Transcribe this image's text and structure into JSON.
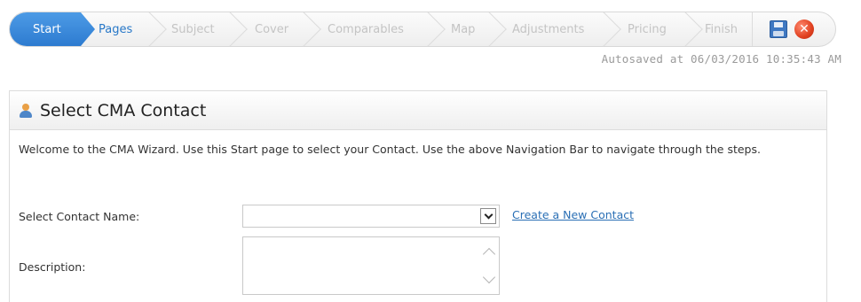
{
  "wizard": {
    "steps": [
      {
        "label": "Start",
        "state": "active"
      },
      {
        "label": "Pages",
        "state": "current"
      },
      {
        "label": "Subject",
        "state": "disabled"
      },
      {
        "label": "Cover",
        "state": "disabled"
      },
      {
        "label": "Comparables",
        "state": "disabled"
      },
      {
        "label": "Map",
        "state": "disabled"
      },
      {
        "label": "Adjustments",
        "state": "disabled"
      },
      {
        "label": "Pricing",
        "state": "disabled"
      },
      {
        "label": "Finish",
        "state": "disabled"
      }
    ],
    "icons": {
      "save": "save-icon",
      "close": "close-icon"
    },
    "colors": {
      "active_step": "#2d7bd0",
      "current_step": "#2878c8",
      "disabled_step": "#c4c4c4",
      "close": "#e0401f"
    }
  },
  "autosave": {
    "text": "Autosaved at 06/03/2016 10:35:43 AM"
  },
  "panel": {
    "icon": "contact-icon",
    "title": "Select CMA Contact",
    "intro": "Welcome to the CMA Wizard. Use this Start page to select your Contact. Use the above Navigation Bar to navigate through the steps.",
    "contact": {
      "label": "Select Contact Name:",
      "value": "",
      "create_link": "Create a New Contact"
    },
    "description": {
      "label": "Description:",
      "value": ""
    }
  }
}
